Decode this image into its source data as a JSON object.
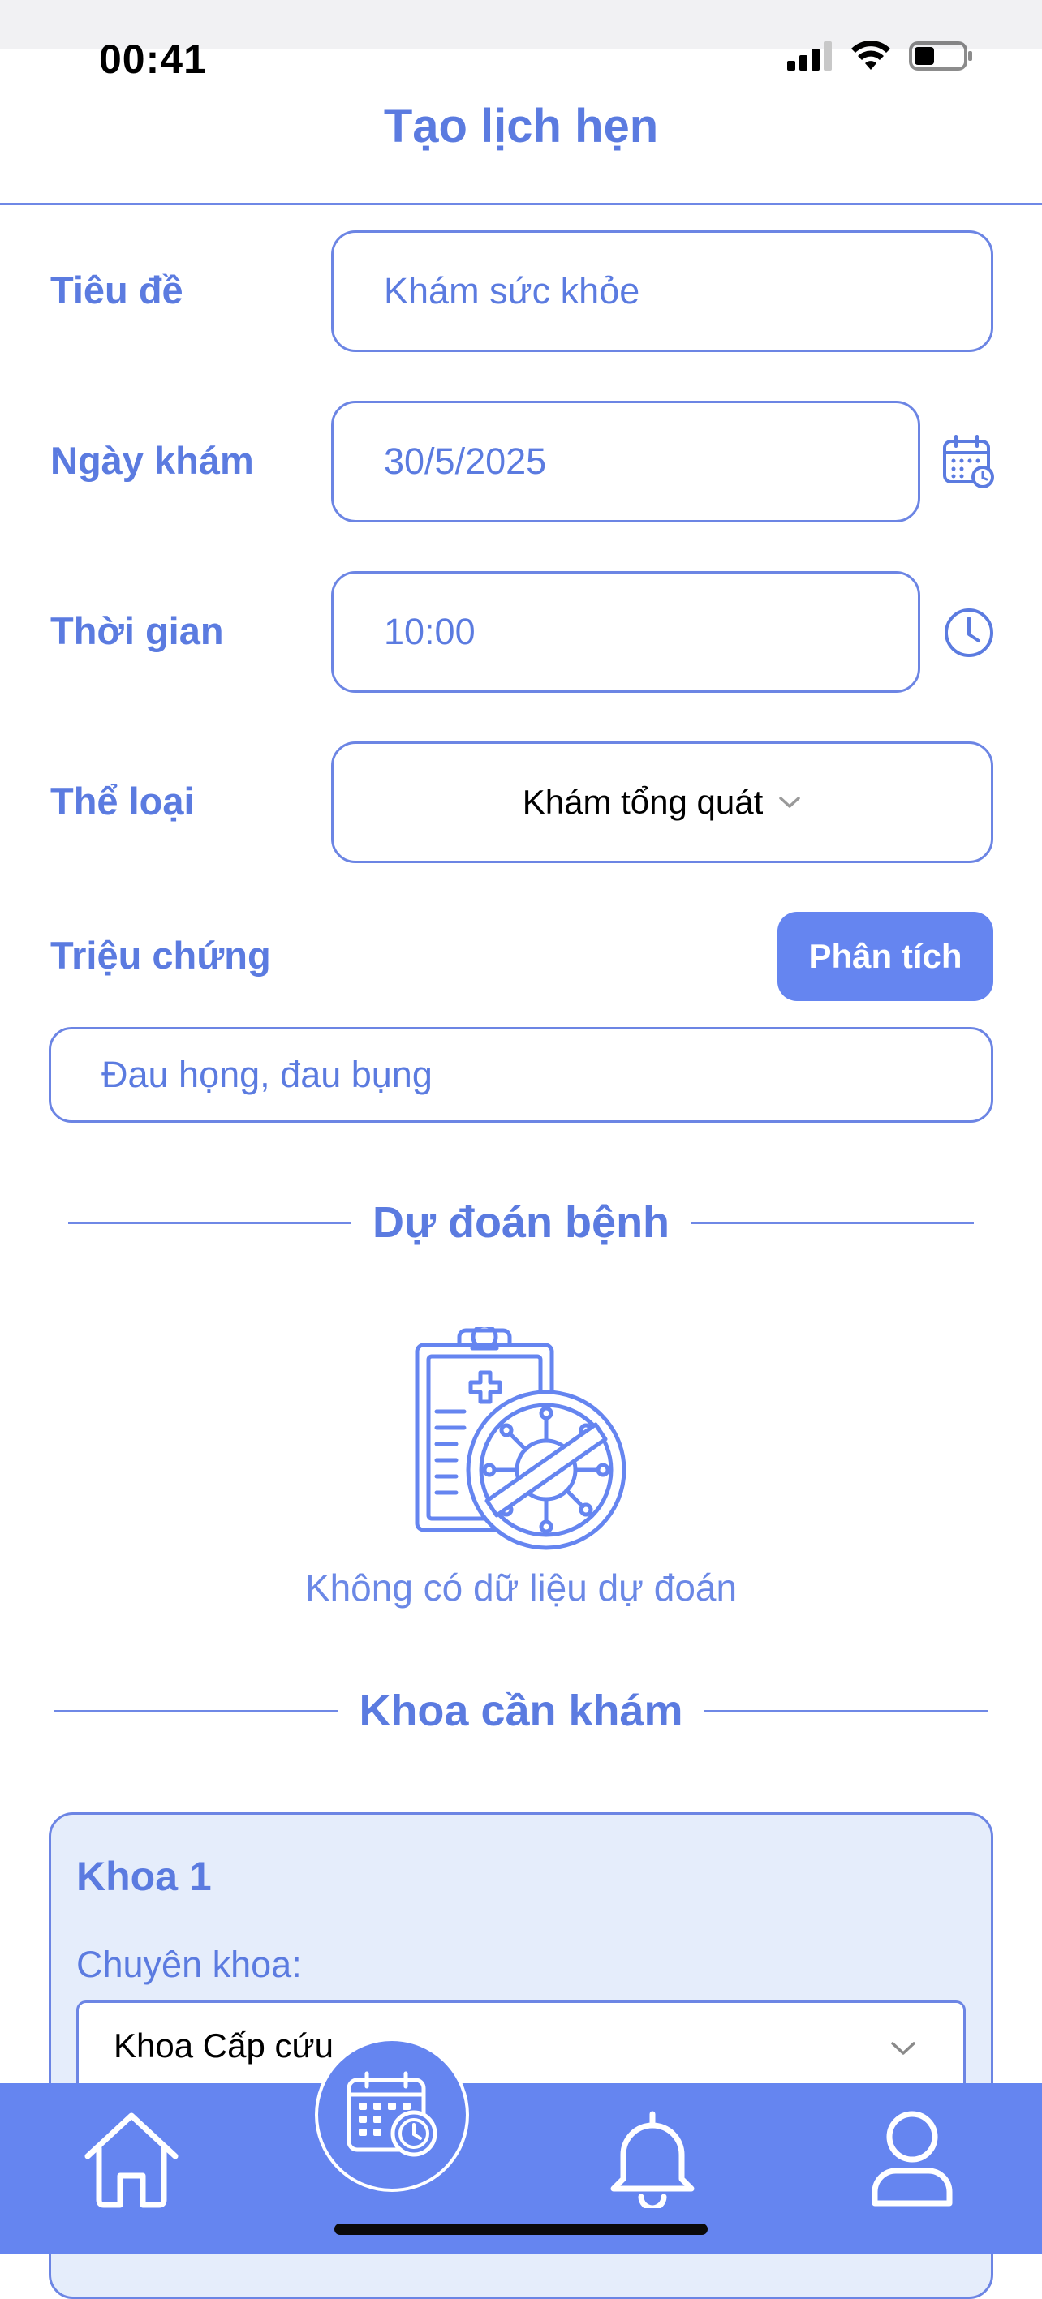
{
  "status_bar": {
    "time": "00:41"
  },
  "header": {
    "title": "Tạo lịch hẹn"
  },
  "form": {
    "title_label": "Tiêu đề",
    "title_placeholder": "Khám sức khỏe",
    "date_label": "Ngày khám",
    "date_value": "30/5/2025",
    "time_label": "Thời gian",
    "time_value": "10:00",
    "type_label": "Thể loại",
    "type_value": "Khám tổng quát",
    "symptoms_label": "Triệu chứng",
    "analyze_button": "Phân tích",
    "symptoms_value": "Đau họng, đau bụng"
  },
  "prediction": {
    "section_title": "Dự đoán bệnh",
    "empty_text": "Không có dữ liệu dự đoán"
  },
  "departments": {
    "section_title": "Khoa cần khám",
    "items": [
      {
        "title": "Khoa 1",
        "specialty_label": "Chuyên khoa:",
        "specialty_value": "Khoa Cấp cứu"
      }
    ]
  },
  "colors": {
    "primary": "#5b7be0",
    "nav_bg": "#6585f0",
    "card_bg": "#e5edfb",
    "border": "#6c85e4"
  },
  "icons": {
    "calendar": "calendar-icon",
    "clock": "clock-icon",
    "dropdown": "chevron-down-icon",
    "no_prediction": "clipboard-no-virus-icon",
    "home": "home-icon",
    "schedule": "calendar-clock-icon",
    "notifications": "bell-icon",
    "profile": "user-icon"
  }
}
